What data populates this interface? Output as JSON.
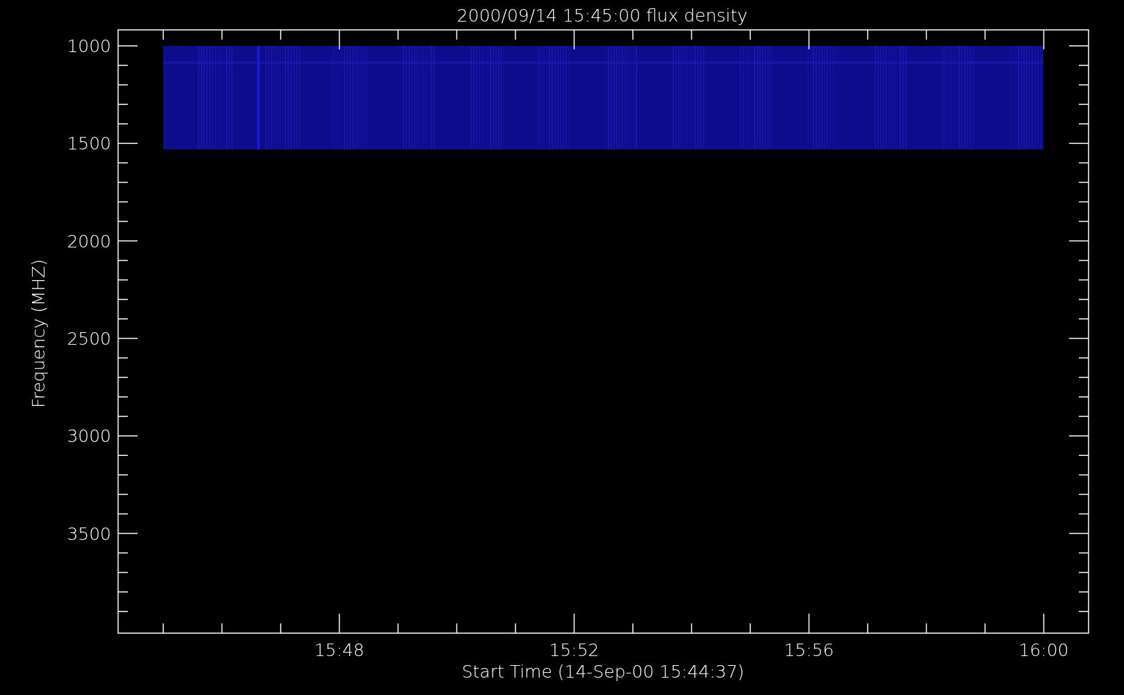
{
  "title": "2000/09/14 15:45:00 flux density",
  "y_axis": {
    "label": "Frequency (MHZ)",
    "tick_labels": [
      "1000",
      "1500",
      "2000",
      "2500",
      "3000",
      "3500"
    ]
  },
  "x_axis": {
    "label": "Start Time (14-Sep-00 15:44:37)",
    "tick_labels": [
      "15:48",
      "15:52",
      "15:56",
      "16:00"
    ]
  }
}
